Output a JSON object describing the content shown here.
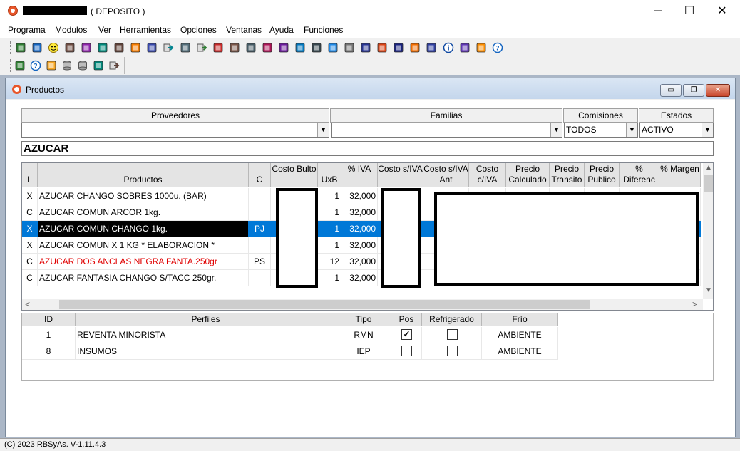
{
  "window": {
    "title": "( DEPOSITO )",
    "minimize_glyph": "─",
    "maximize_glyph": "☐",
    "close_glyph": "✕"
  },
  "menu": [
    "Programa",
    "Modulos",
    "Ver",
    "Herramientas",
    "Opciones",
    "Ventanas",
    "Ayuda",
    "Funciones"
  ],
  "toolbar1_icons": [
    "grid-icon",
    "running-man-icon",
    "smiley-icon",
    "calendar-icon",
    "cabinet-icon",
    "money-bag-icon",
    "bank-icon",
    "notes-icon",
    "table-icon",
    "back-arrow-icon",
    "computer-icon",
    "forward-arrow-icon",
    "truck-icon",
    "clipboard-icon",
    "cursor-icon",
    "abacus-icon",
    "calculator-icon",
    "list-icon",
    "lock-print-icon",
    "scanner-icon",
    "ticket-icon",
    "dots-grid-icon",
    "users-icon",
    "spreadsheet-icon",
    "pencil-box-icon",
    "stack-icon",
    "info-icon",
    "copy-icon",
    "edit-icon",
    "help-icon"
  ],
  "toolbar2_icons": [
    "book-icon",
    "help-icon",
    "gear-icon",
    "database-icon",
    "database-alt-icon",
    "save-icon",
    "exit-icon"
  ],
  "child": {
    "title": "Productos",
    "minimize_glyph": "▭",
    "restore_glyph": "❐",
    "close_glyph": "✕"
  },
  "filters": {
    "proveedores": {
      "label": "Proveedores",
      "value": ""
    },
    "familias": {
      "label": "Familias",
      "value": ""
    },
    "comisiones": {
      "label": "Comisiones",
      "value": "TODOS"
    },
    "estados": {
      "label": "Estados",
      "value": "ACTIVO"
    },
    "dropdown_glyph": "▼"
  },
  "search": {
    "value": "AZUCAR"
  },
  "products": {
    "columns": {
      "l": "L",
      "productos": "Productos",
      "c": "C",
      "costo_bulto": "Costo Bulto",
      "uxb": "UxB",
      "iva": "% IVA",
      "costo_siva": "Costo s/IVA",
      "costo_siva_ant": "Costo s/IVA Ant",
      "costo_civa": "Costo c/IVA",
      "precio_calc": "Precio Calculado",
      "precio_transito": "Precio Transito",
      "precio_publico": "Precio Publico",
      "diferenc": "% Diferenc",
      "margen": "% Margen"
    },
    "rows": [
      {
        "l": "X",
        "producto": "AZUCAR CHANGO SOBRES 1000u. (BAR)",
        "c": "",
        "uxb": "1",
        "iva": "32,000",
        "selected": false,
        "color": "normal"
      },
      {
        "l": "C",
        "producto": "AZUCAR COMUN ARCOR 1kg.",
        "c": "",
        "uxb": "1",
        "iva": "32,000",
        "selected": false,
        "color": "normal"
      },
      {
        "l": "X",
        "producto": "AZUCAR COMUN CHANGO 1kg.",
        "c": "PJ",
        "uxb": "1",
        "iva": "32,000",
        "selected": true,
        "color": "normal"
      },
      {
        "l": "X",
        "producto": "AZUCAR COMUN X 1 KG * ELABORACION *",
        "c": "",
        "uxb": "1",
        "iva": "32,000",
        "selected": false,
        "color": "normal"
      },
      {
        "l": "C",
        "producto": "AZUCAR DOS ANCLAS NEGRA FANTA.250gr",
        "c": "PS",
        "uxb": "12",
        "iva": "32,000",
        "selected": false,
        "color": "red"
      },
      {
        "l": "C",
        "producto": "AZUCAR FANTASIA CHANGO S/TACC 250gr.",
        "c": "",
        "uxb": "1",
        "iva": "32,000",
        "selected": false,
        "color": "normal"
      }
    ],
    "scroll_up": "▲",
    "scroll_down": "▼",
    "scroll_left": "<",
    "scroll_right": ">",
    "scroll_position": {
      "horizontal_fraction": 0.78,
      "vertical_fraction": 0.13
    }
  },
  "profiles": {
    "columns": {
      "id": "ID",
      "perfiles": "Perfiles",
      "tipo": "Tipo",
      "pos": "Pos",
      "refrigerado": "Refrigerado",
      "frio": "Frío"
    },
    "rows": [
      {
        "id": "1",
        "perfil": "REVENTA MINORISTA",
        "tipo": "RMN",
        "pos": true,
        "refrigerado": false,
        "frio": "AMBIENTE"
      },
      {
        "id": "8",
        "perfil": "INSUMOS",
        "tipo": "IEP",
        "pos": false,
        "refrigerado": false,
        "frio": "AMBIENTE"
      }
    ],
    "check_glyph": "✓"
  },
  "status": {
    "text": "(C) 2023 RBSyAs. V-1.11.4.3"
  }
}
